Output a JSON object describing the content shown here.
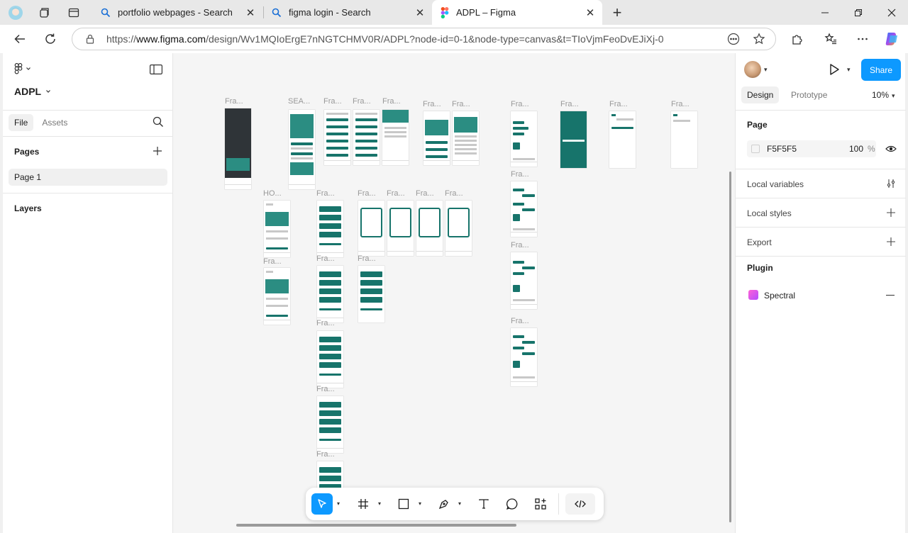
{
  "browser": {
    "tabs": [
      {
        "title": "portfolio webpages - Search",
        "close": "✕"
      },
      {
        "title": "figma login - Search",
        "close": "✕"
      },
      {
        "title": "ADPL – Figma",
        "close": "✕"
      }
    ],
    "new_tab": "+",
    "url_prefix": "https://",
    "url_host": "www.figma.com",
    "url_path": "/design/Wv1MQIoErgE7nNGTCHMV0R/ADPL?node-id=0-1&node-type=canvas&t=TIoVjmFeoDvEJiXj-0"
  },
  "left_panel": {
    "file_name": "ADPL",
    "tabs": [
      {
        "label": "File"
      },
      {
        "label": "Assets"
      }
    ],
    "pages_heading": "Pages",
    "pages": [
      {
        "label": "Page 1"
      }
    ],
    "layers_heading": "Layers"
  },
  "right_panel": {
    "share_label": "Share",
    "tabs": [
      {
        "label": "Design"
      },
      {
        "label": "Prototype"
      }
    ],
    "zoom": "10%",
    "page_heading": "Page",
    "fill_hex": "F5F5F5",
    "fill_opacity": "100",
    "opacity_unit": "%",
    "local_variables": "Local variables",
    "local_styles": "Local styles",
    "export": "Export",
    "plugin_heading": "Plugin",
    "plugin_name": "Spectral"
  },
  "canvas": {
    "frame_labels": {
      "f1": "Fra...",
      "sea": "SEA...",
      "f3": "Fra...",
      "f4": "Fra...",
      "f5": "Fra...",
      "f6": "Fra...",
      "f7": "Fra...",
      "f8": "Fra...",
      "f9": "Fra...",
      "f10": "Fra...",
      "f11": "Fra...",
      "ho": "HO...",
      "f12": "Fra...",
      "f13": "Fra...",
      "f14": "Fra...",
      "f15": "Fra...",
      "f16": "Fra...",
      "f17": "Fra...",
      "f18": "Fra...",
      "f19": "Fra...",
      "f20": "Fra...",
      "f21": "Fra...",
      "f22": "Fra...",
      "f23": "Fra...",
      "f24": "Fra..."
    },
    "background": "#F5F5F5",
    "accent": "#17746B"
  },
  "help_label": "?",
  "colors": {
    "share": "#0D99FF",
    "active_tool": "#0D99FF",
    "frame_teal": "#17746B"
  }
}
